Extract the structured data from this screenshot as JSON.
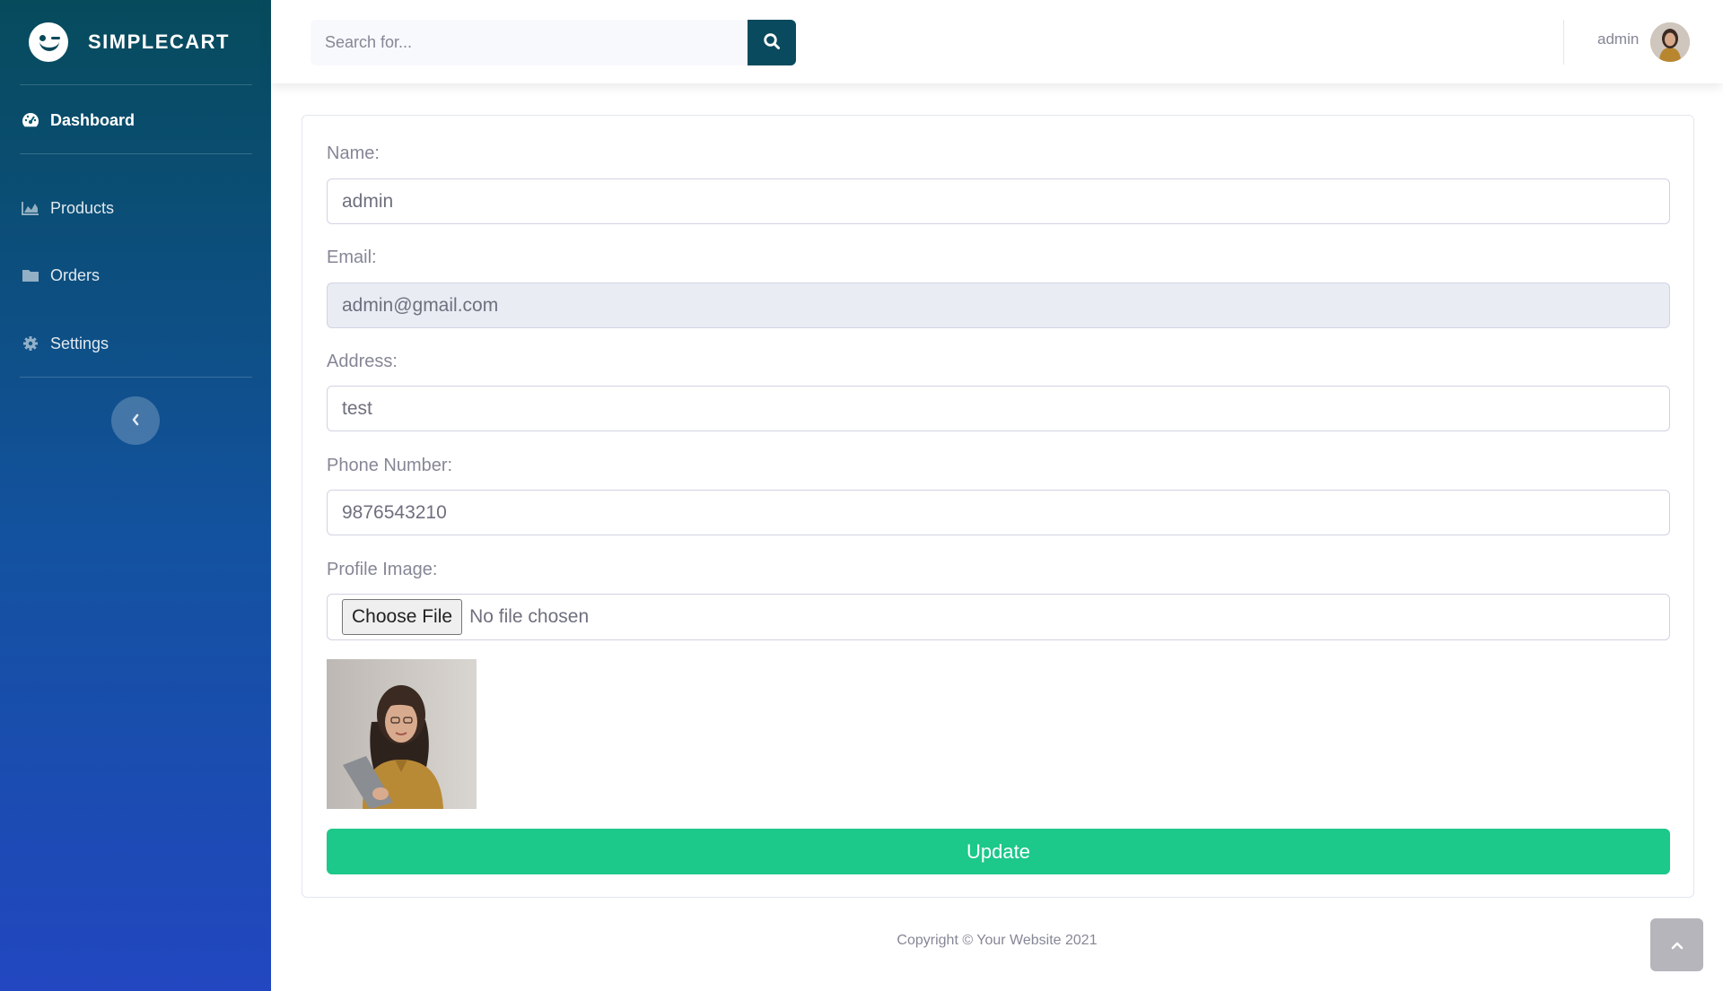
{
  "brand": {
    "name": "SIMPLECART",
    "logo_icon": "smile-wink-icon"
  },
  "sidebar": {
    "items": [
      {
        "label": "Dashboard",
        "icon": "tachometer-icon",
        "active": true
      },
      {
        "label": "Products",
        "icon": "chart-area-icon",
        "active": false
      },
      {
        "label": "Orders",
        "icon": "folder-icon",
        "active": false
      },
      {
        "label": "Settings",
        "icon": "cog-icon",
        "active": false
      }
    ],
    "toggle_icon": "chevron-left-icon"
  },
  "topbar": {
    "search_placeholder": "Search for...",
    "search_icon": "search-icon",
    "user_name": "admin"
  },
  "form": {
    "name_label": "Name:",
    "name_value": "admin",
    "email_label": "Email:",
    "email_value": "admin@gmail.com",
    "address_label": "Address:",
    "address_value": "test",
    "phone_label": "Phone Number:",
    "phone_value": "9876543210",
    "image_label": "Profile Image:",
    "file_button": "Choose File",
    "file_status": "No file chosen",
    "submit_label": "Update"
  },
  "footer": {
    "copyright": "Copyright © Your Website 2021"
  },
  "colors": {
    "sidebar_top": "#064b5c",
    "sidebar_bottom": "#2247c0",
    "search_button": "#0a4a5e",
    "update_button": "#1cc88a",
    "readonly_field": "#eaecf4"
  }
}
